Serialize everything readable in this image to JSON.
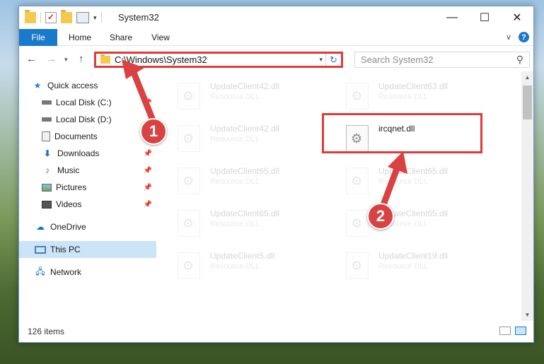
{
  "window": {
    "title": "System32",
    "minimize": "—",
    "maximize": "☐",
    "close": "✕"
  },
  "ribbon": {
    "tabs": [
      "File",
      "Home",
      "Share",
      "View"
    ]
  },
  "navbar": {
    "back": "←",
    "forward": "→",
    "recent": "▾",
    "up": "↑",
    "address": "C:\\Windows\\System32",
    "search_placeholder": "Search System32"
  },
  "sidebar": {
    "items": [
      {
        "label": "Quick access",
        "icon": "star-icon",
        "pinned": false
      },
      {
        "label": "Local Disk (C:)",
        "icon": "drive-icon",
        "pinned": true
      },
      {
        "label": "Local Disk (D:)",
        "icon": "drive-icon",
        "pinned": false
      },
      {
        "label": "Documents",
        "icon": "documents-icon",
        "pinned": true
      },
      {
        "label": "Downloads",
        "icon": "downloads-icon",
        "pinned": true
      },
      {
        "label": "Music",
        "icon": "music-icon",
        "pinned": true
      },
      {
        "label": "Pictures",
        "icon": "pictures-icon",
        "pinned": true
      },
      {
        "label": "Videos",
        "icon": "videos-icon",
        "pinned": true
      },
      {
        "label": "OneDrive",
        "icon": "onedrive-icon",
        "pinned": false
      },
      {
        "label": "This PC",
        "icon": "this-pc-icon",
        "pinned": false,
        "selected": true
      },
      {
        "label": "Network",
        "icon": "network-icon",
        "pinned": false
      }
    ]
  },
  "files": [
    {
      "name": "UpdateClient42.dll",
      "type": "Resource DLL"
    },
    {
      "name": "UpdateClient63.dll",
      "type": "Resource DLL"
    },
    {
      "name": "UpdateClient42.dll",
      "type": "Resource DLL"
    },
    {
      "name": "ircqnet.dll",
      "type": ""
    },
    {
      "name": "UpdateClient65.dll",
      "type": "Resource DLL"
    },
    {
      "name": "UpdateClient65.dll",
      "type": "Resource DLL"
    },
    {
      "name": "UpdateClient65.dll",
      "type": "Resource DLL"
    },
    {
      "name": "UpdateClient65.dll",
      "type": "Resource DLL"
    },
    {
      "name": "UpdateClient5.dll",
      "type": "Resource DLL"
    },
    {
      "name": "UpdateClient19.dll",
      "type": "Resource DLL"
    }
  ],
  "status": {
    "item_count": "126 items"
  },
  "callouts": {
    "one": "1",
    "two": "2"
  },
  "colors": {
    "accent": "#1979ca",
    "callout": "#d94242",
    "selected_bg": "#cce4f7"
  }
}
